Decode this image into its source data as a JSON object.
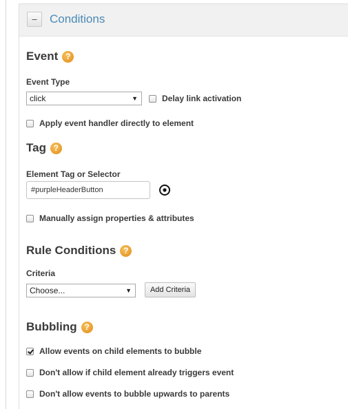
{
  "panel": {
    "collapse_symbol": "–",
    "title": "Conditions"
  },
  "event": {
    "title": "Event",
    "help": "?",
    "type_label": "Event Type",
    "type_value": "click",
    "delay_label": "Delay link activation",
    "delay_checked": false,
    "apply_handler_label": "Apply event handler directly to element",
    "apply_handler_checked": false
  },
  "tag": {
    "title": "Tag",
    "help": "?",
    "selector_label": "Element Tag or Selector",
    "selector_value": "#purpleHeaderButton",
    "target_icon": "target-icon",
    "manual_label": "Manually assign properties & attributes",
    "manual_checked": false
  },
  "rule_conditions": {
    "title": "Rule Conditions",
    "help": "?",
    "criteria_label": "Criteria",
    "criteria_value": "Choose...",
    "add_button": "Add Criteria"
  },
  "bubbling": {
    "title": "Bubbling",
    "help": "?",
    "options": [
      {
        "label": "Allow events on child elements to bubble",
        "checked": true
      },
      {
        "label": "Don't allow if child element already triggers event",
        "checked": false
      },
      {
        "label": "Don't allow events to bubble upwards to parents",
        "checked": false
      }
    ]
  },
  "colors": {
    "title_blue": "#4a8ab5",
    "help_orange": "#e8961e",
    "header_bg": "#f1f1f1"
  }
}
